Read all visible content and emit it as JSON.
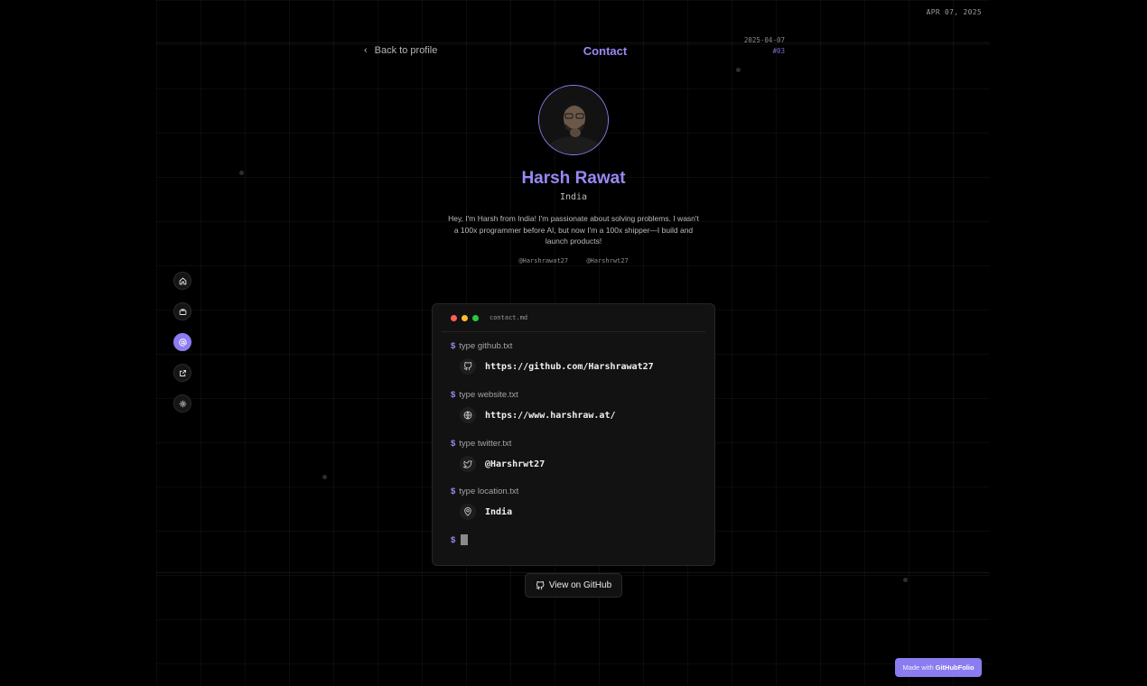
{
  "corner_date": "APR 07, 2025",
  "header": {
    "back_label": "Back to profile",
    "title": "Contact",
    "date": "2025-04-07",
    "number": "#03"
  },
  "profile": {
    "name": "Harsh Rawat",
    "country": "India",
    "bio": "Hey, I'm Harsh from India! I'm passionate about solving problems. I wasn't a 100x programmer before AI, but now I'm a 100x shipper—I build and launch products!",
    "github_handle": "@Harshrawat27",
    "twitter_handle": "@Harshrwt27"
  },
  "nav": {
    "items": [
      {
        "icon": "home-icon",
        "active": false
      },
      {
        "icon": "briefcase-icon",
        "active": false
      },
      {
        "icon": "at-sign-icon",
        "active": true
      },
      {
        "icon": "external-link-icon",
        "active": false
      },
      {
        "icon": "sun-icon",
        "active": false
      }
    ]
  },
  "terminal": {
    "filename": "contact.md",
    "prompt": "$",
    "entries": [
      {
        "command": "type github.txt",
        "icon": "github-icon",
        "value": "https://github.com/Harshrawat27"
      },
      {
        "command": "type website.txt",
        "icon": "globe-icon",
        "value": "https://www.harshraw.at/"
      },
      {
        "command": "type twitter.txt",
        "icon": "twitter-icon",
        "value": "@Harshrwt27"
      },
      {
        "command": "type location.txt",
        "icon": "map-pin-icon",
        "value": "India"
      }
    ]
  },
  "github_button": "View on GitHub",
  "made_with": {
    "prefix": "Made with",
    "brand": "GitHubFolio"
  },
  "colors": {
    "accent": "#9b87f5",
    "background": "#000000",
    "terminal_bg": "#121212",
    "traffic_red": "#ff5f56",
    "traffic_yellow": "#ffbd2e",
    "traffic_green": "#27c93f"
  }
}
